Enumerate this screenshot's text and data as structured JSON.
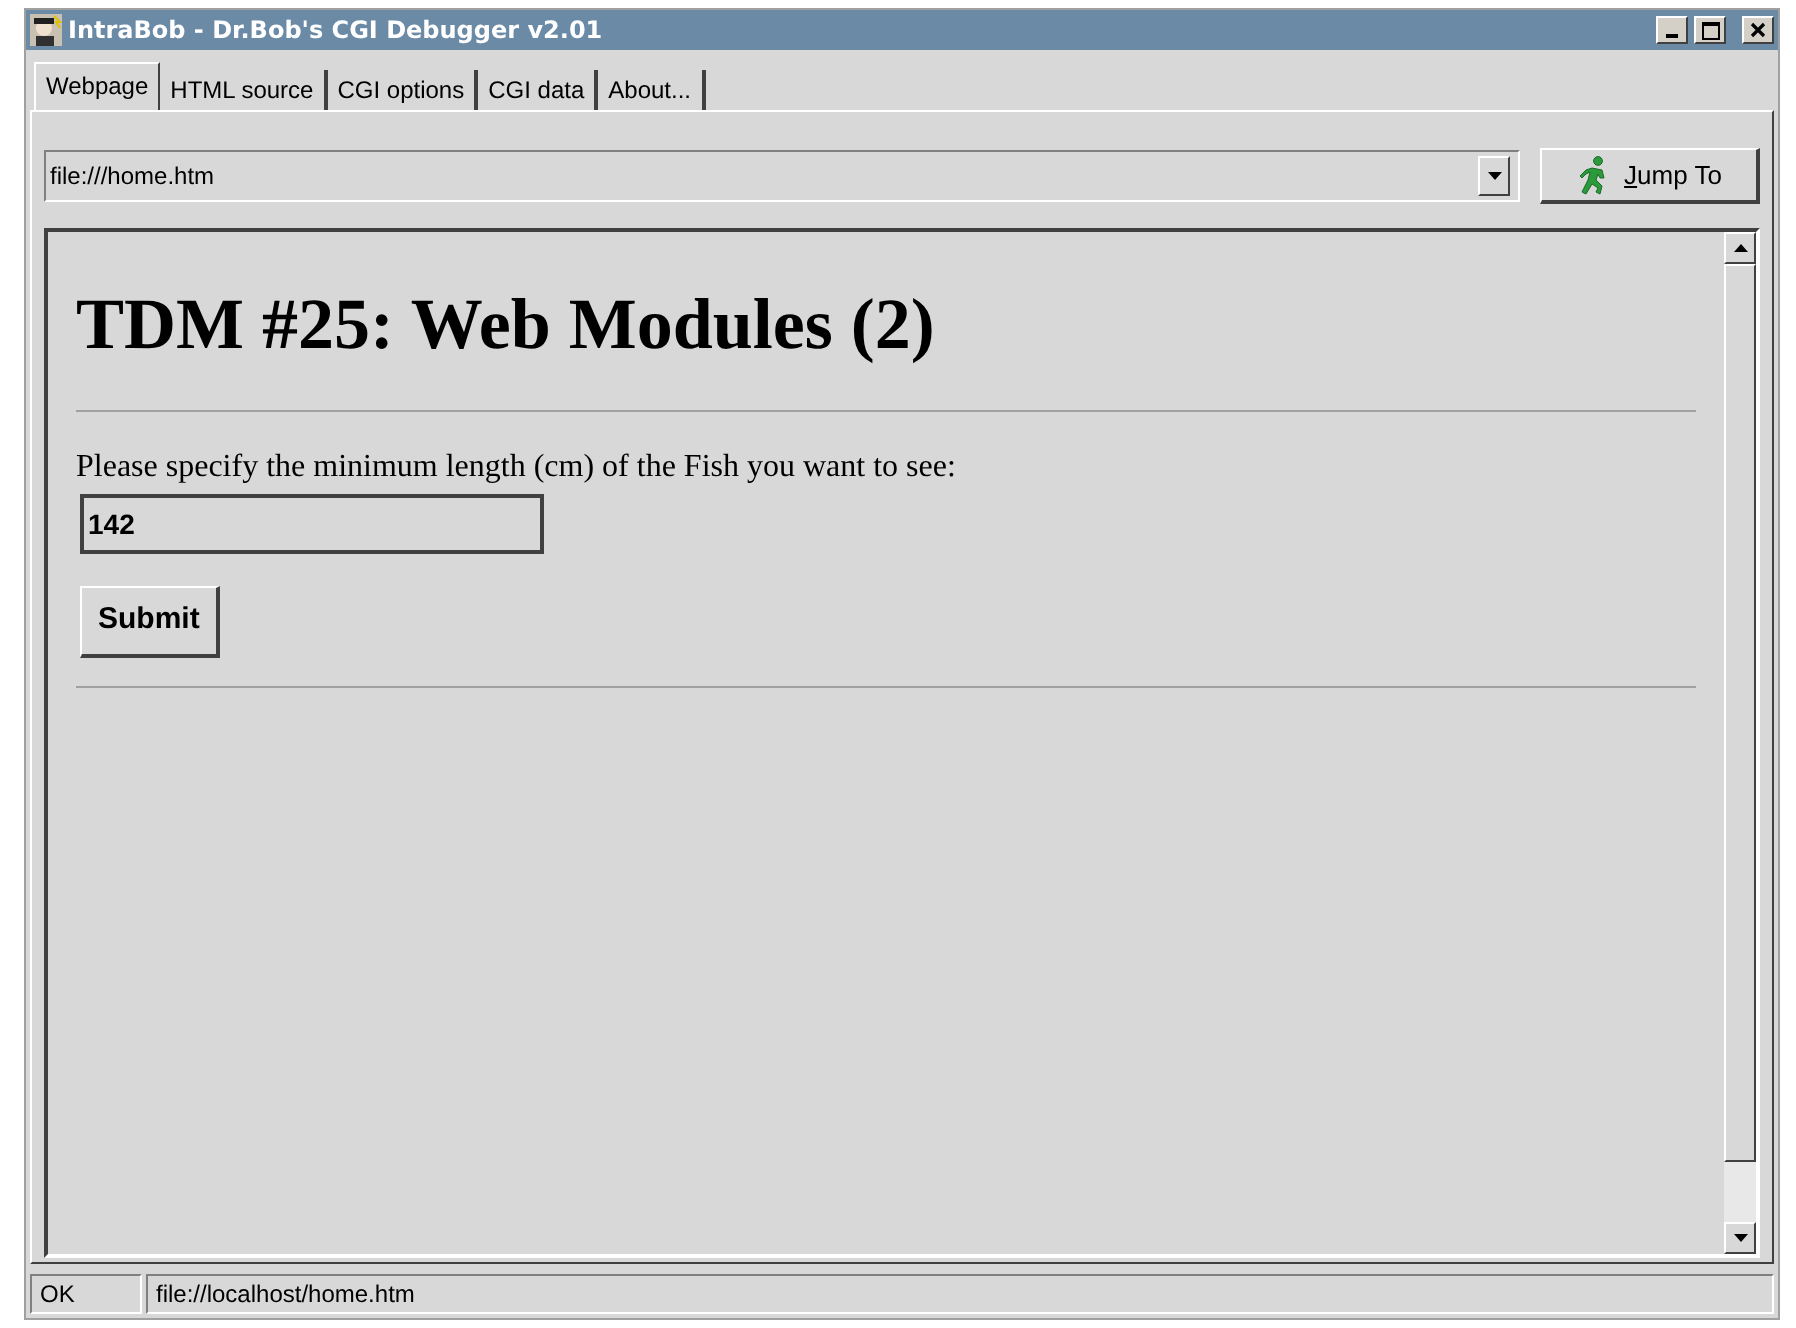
{
  "window": {
    "title": "IntraBob - Dr.Bob's CGI Debugger v2.01"
  },
  "tabs": [
    {
      "label": "Webpage",
      "selected": true
    },
    {
      "label": "HTML source",
      "selected": false
    },
    {
      "label": "CGI options",
      "selected": false
    },
    {
      "label": "CGI data",
      "selected": false
    },
    {
      "label": "About...",
      "selected": false
    }
  ],
  "address": {
    "value": "file:///home.htm"
  },
  "jump_button": {
    "label": "Jump To"
  },
  "page": {
    "heading": "TDM #25: Web Modules (2)",
    "prompt": "Please specify the minimum length (cm) of the Fish you want to see:",
    "input_value": "142",
    "submit_label": "Submit"
  },
  "status_bar": {
    "state": "OK",
    "url": "file://localhost/home.htm"
  }
}
